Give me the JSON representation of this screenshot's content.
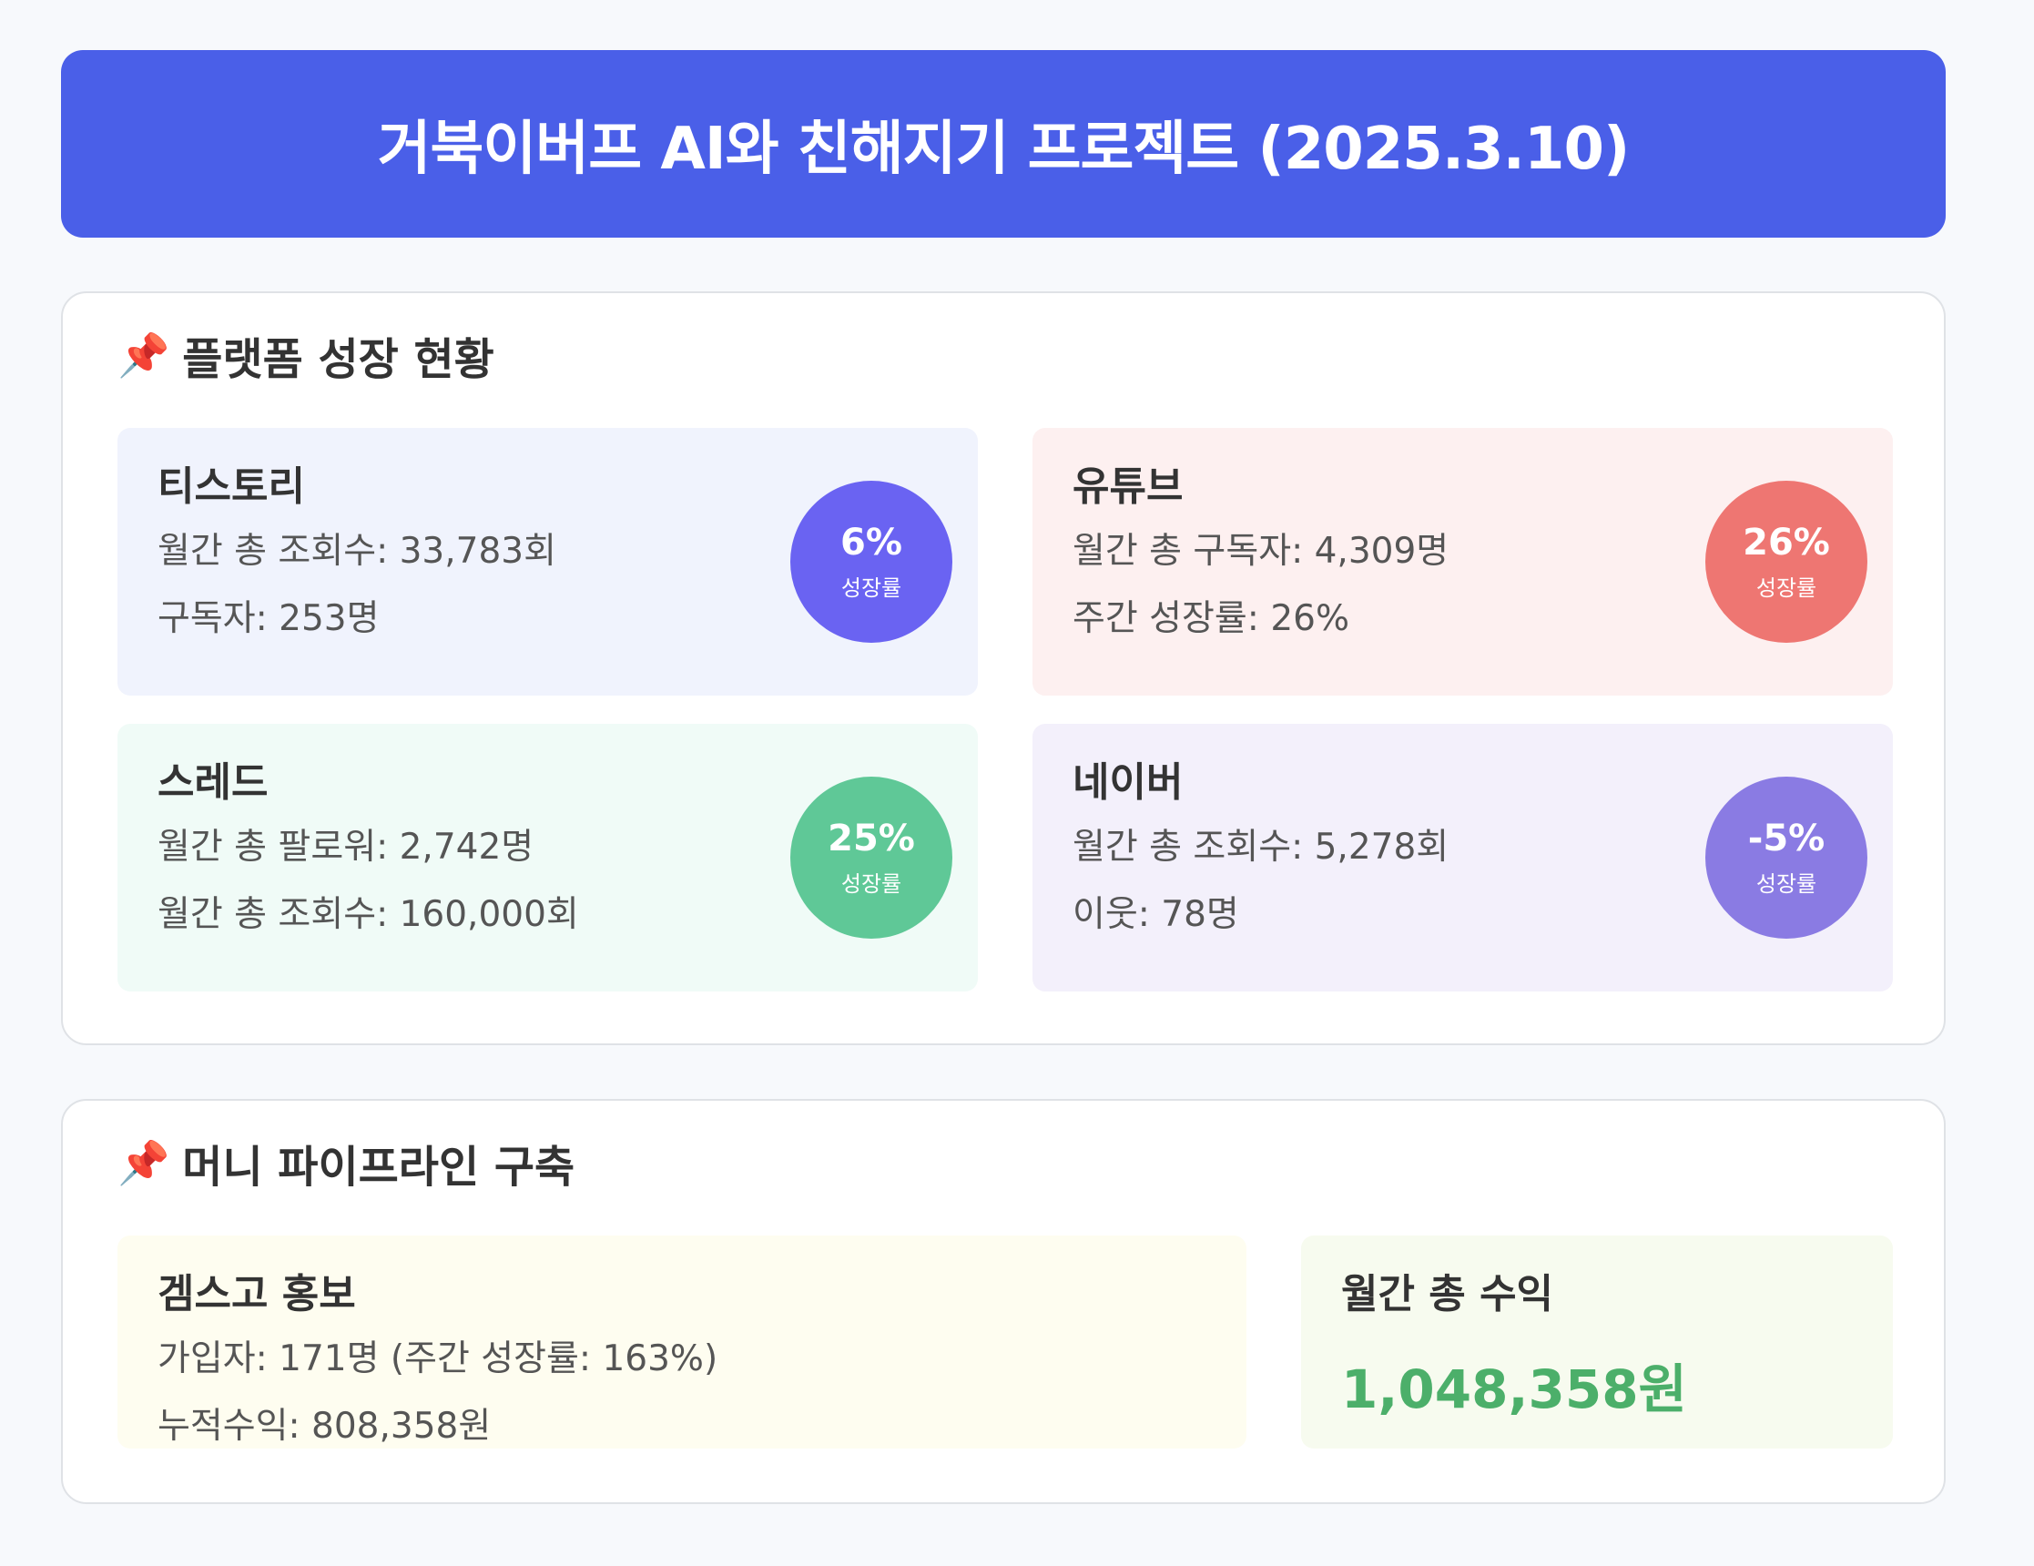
{
  "header": {
    "title": "거북이버프 AI와 친해지기 프로젝트 (2025.3.10)"
  },
  "growth": {
    "title": "플랫폼 성장 현황",
    "pin_icon": "pushpin-icon",
    "cards": [
      {
        "name": "티스토리",
        "line1": "월간 총 조회수: 33,783회",
        "line2": "구독자: 253명",
        "rate": "6%",
        "rate_label": "성장률",
        "color": "#6a63f2",
        "bg": "#f0f3fd"
      },
      {
        "name": "유튜브",
        "line1": "월간 총 구독자: 4,309명",
        "line2": "주간 성장률: 26%",
        "rate": "26%",
        "rate_label": "성장률",
        "color": "#ee7672",
        "bg": "#fdf0f0"
      },
      {
        "name": "스레드",
        "line1": "월간 총 팔로워: 2,742명",
        "line2": "월간 총 조회수: 160,000회",
        "rate": "25%",
        "rate_label": "성장률",
        "color": "#5fc897",
        "bg": "#f0fbf7"
      },
      {
        "name": "네이버",
        "line1": "월간 총 조회수: 5,278회",
        "line2": "이웃: 78명",
        "rate": "-5%",
        "rate_label": "성장률",
        "color": "#8a7be3",
        "bg": "#f3f0fb"
      }
    ]
  },
  "money": {
    "title": "머니 파이프라인 구축",
    "pin_icon": "pushpin-icon",
    "gemsgo": {
      "name": "겜스고 홍보",
      "line1": "가입자: 171명 (주간 성장률: 163%)",
      "line2": "누적수익: 808,358원"
    },
    "total": {
      "label": "월간 총 수익",
      "value": "1,048,358원",
      "color": "#4caf6a"
    }
  },
  "colors": {
    "banner": "#4a5fe8",
    "background": "#f7f9fc"
  }
}
